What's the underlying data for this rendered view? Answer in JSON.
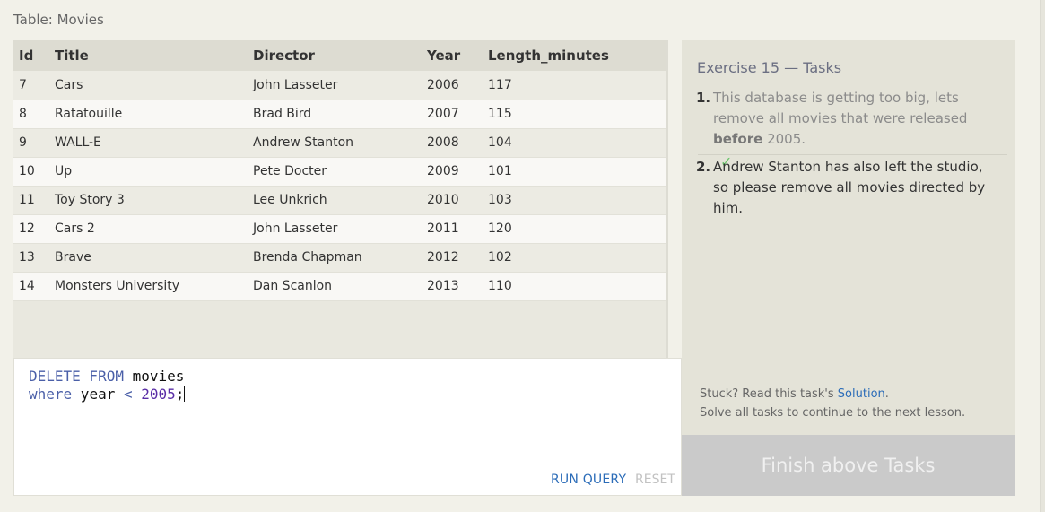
{
  "table": {
    "caption": "Table: Movies",
    "columns": [
      "Id",
      "Title",
      "Director",
      "Year",
      "Length_minutes"
    ],
    "rows": [
      [
        "7",
        "Cars",
        "John Lasseter",
        "2006",
        "117"
      ],
      [
        "8",
        "Ratatouille",
        "Brad Bird",
        "2007",
        "115"
      ],
      [
        "9",
        "WALL-E",
        "Andrew Stanton",
        "2008",
        "104"
      ],
      [
        "10",
        "Up",
        "Pete Docter",
        "2009",
        "101"
      ],
      [
        "11",
        "Toy Story 3",
        "Lee Unkrich",
        "2010",
        "103"
      ],
      [
        "12",
        "Cars 2",
        "John Lasseter",
        "2011",
        "120"
      ],
      [
        "13",
        "Brave",
        "Brenda Chapman",
        "2012",
        "102"
      ],
      [
        "14",
        "Monsters University",
        "Dan Scanlon",
        "2013",
        "110"
      ]
    ]
  },
  "editor": {
    "line1_kw": "DELETE FROM",
    "line1_rest": " movies",
    "line2_kw": "where",
    "line2_mid": " year ",
    "line2_op": "<",
    "line2_num": " 2005",
    "line2_end": ";",
    "run_label": "RUN QUERY",
    "reset_label": "RESET"
  },
  "tasks": {
    "title": "Exercise 15 — Tasks",
    "items": [
      {
        "num": "1.",
        "text_before": "This database is getting too big, lets remove all movies that were released ",
        "text_bold": "before",
        "text_after": " 2005.",
        "check": "✓",
        "completed": true
      },
      {
        "num": "2.",
        "text": "Andrew Stanton has also left the studio, so please remove all movies directed by him.",
        "completed": false
      }
    ],
    "stuck_prefix": "Stuck? Read this task's ",
    "stuck_link": "Solution",
    "stuck_suffix": ".",
    "continue_text": "Solve all tasks to continue to the next lesson.",
    "finish_label": "Finish above Tasks"
  },
  "colors": {
    "background": "#f2f1e9",
    "link": "#2b6cb8",
    "check": "#6cc46c",
    "finish_disabled": "#cacaca"
  }
}
